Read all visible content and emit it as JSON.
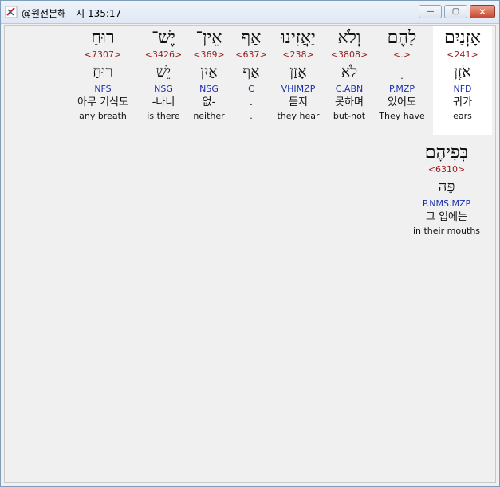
{
  "window": {
    "title": "@원전본해 - 시 135:17",
    "min_glyph": "—",
    "max_glyph": "▢",
    "close_glyph": "✕"
  },
  "words": [
    {
      "hebrew": "אָזְנַיִם",
      "strong": "<241>",
      "root": "אֹזֶן",
      "morph": "NFD",
      "korean": "귀가",
      "english": "ears",
      "selected": true
    },
    {
      "hebrew": "לָהֶם",
      "strong": "<.>",
      "root": "ִ",
      "morph": "P.MZP",
      "korean": "있어도",
      "english": "They have"
    },
    {
      "hebrew": "וְלֹא",
      "strong": "<3808>",
      "root": "לֹא",
      "morph": "C.ABN",
      "korean": "못하며",
      "english": "but-not"
    },
    {
      "hebrew": "יַאֲזִינוּ",
      "strong": "<238>",
      "root": "אָזַן",
      "morph": "VHIMZP",
      "korean": "듣지",
      "english": "they hear"
    },
    {
      "hebrew": "אַף",
      "strong": "<637>",
      "root": "אַף",
      "morph": "C",
      "korean": ".",
      "english": "."
    },
    {
      "hebrew": "אֵין־",
      "strong": "<369>",
      "root": "אַיִן",
      "morph": "NSG",
      "korean": "없-",
      "english": "neither"
    },
    {
      "hebrew": "יֶשׁ־",
      "strong": "<3426>",
      "root": "יֵשׁ",
      "morph": "NSG",
      "korean": "-나니",
      "english": "is there"
    },
    {
      "hebrew": "רוּחַ",
      "strong": "<7307>",
      "root": "רוּחַ",
      "morph": "NFS",
      "korean": "아무 기식도",
      "english": "any breath"
    },
    {
      "hebrew": "בְּפִיהֶם׃",
      "strong": "<6310>",
      "root": "פֶּה",
      "morph": "P.NMS.MZP",
      "korean": "그 입에는",
      "english": "in their mouths"
    }
  ]
}
